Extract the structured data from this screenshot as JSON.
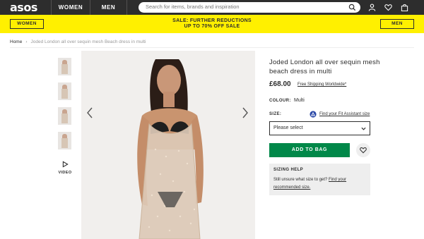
{
  "header": {
    "logo": "asos",
    "nav": [
      "WOMEN",
      "MEN"
    ],
    "search_placeholder": "Search for items, brands and inspiration",
    "icons": [
      "search-icon",
      "account-icon",
      "heart-icon",
      "bag-icon"
    ]
  },
  "banner": {
    "women_label": "WOMEN",
    "men_label": "MEN",
    "line1": "SALE: FURTHER REDUCTIONS",
    "line2": "UP TO 70% OFF SALE",
    "color": "#fff000"
  },
  "breadcrumb": {
    "home": "Home",
    "current": "Joded London all over sequin mesh Beach dress in multi"
  },
  "gallery": {
    "video_label": "VIDEO",
    "thumbnail_count": 4
  },
  "product": {
    "title": "Joded London all over sequin mesh beach dress in multi",
    "price": "£68.00",
    "shipping_link": "Free Shipping Worldwide*",
    "colour_label": "COLOUR:",
    "colour_value": "Multi",
    "size_label": "SIZE:",
    "fit_link": "Find your Fit Assistant size",
    "size_select": "Please select",
    "add_to_bag": "ADD TO BAG",
    "add_to_bag_color": "#018849"
  },
  "sizing_help": {
    "title": "SIZING HELP",
    "text": "Still unsure what size to get?",
    "link": "Find your recommended size."
  }
}
